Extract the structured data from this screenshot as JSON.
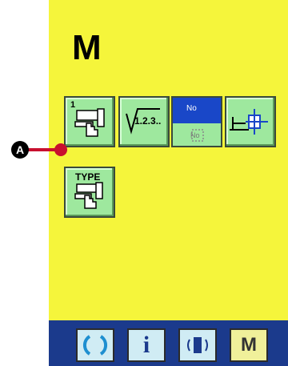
{
  "screen": {
    "title": "M",
    "background": "#f5f53b"
  },
  "marker": {
    "label": "A",
    "pointer_color": "#c8102e"
  },
  "buttons": {
    "memory_switch": {
      "number": "1",
      "icon": "sewing-machine-hand-icon"
    },
    "counter": {
      "label": "1.2.3..",
      "icon": "counter-icon"
    },
    "program_no": {
      "label_top": "No",
      "label_bottom": "No",
      "icon": "program-number-icon"
    },
    "thread_clamp": {
      "icon": "feed-position-icon"
    },
    "type": {
      "label": "TYPE",
      "icon": "sewing-machine-hand-icon"
    }
  },
  "bottom_bar": {
    "background": "#1b3a8c",
    "keys": [
      {
        "name": "ready",
        "icon": "ready-ring-icon"
      },
      {
        "name": "info",
        "label": "i",
        "icon": "info-icon"
      },
      {
        "name": "communication",
        "icon": "communication-icon"
      },
      {
        "name": "mode",
        "label": "M",
        "icon": "mode-icon"
      }
    ]
  }
}
